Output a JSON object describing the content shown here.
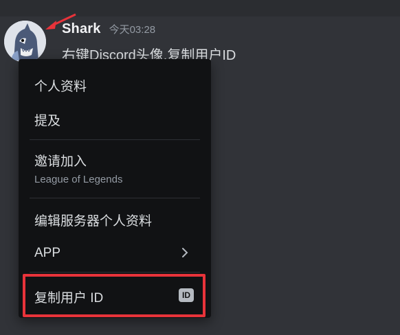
{
  "message": {
    "username": "Shark",
    "timestamp": "今天03:28",
    "content": "右键Discord头像,复制用户ID"
  },
  "context_menu": {
    "items": [
      {
        "label": "个人资料"
      },
      {
        "label": "提及"
      },
      {
        "label": "邀请加入",
        "sublabel": "League of Legends"
      },
      {
        "label": "编辑服务器个人资料"
      },
      {
        "label": "APP",
        "icon": "chevron-right-icon"
      },
      {
        "label": "复制用户 ID",
        "badge": "ID",
        "highlighted": true
      }
    ]
  },
  "colors": {
    "background": "#313338",
    "menu_background": "#111214",
    "annotation_red": "#e8333a"
  }
}
